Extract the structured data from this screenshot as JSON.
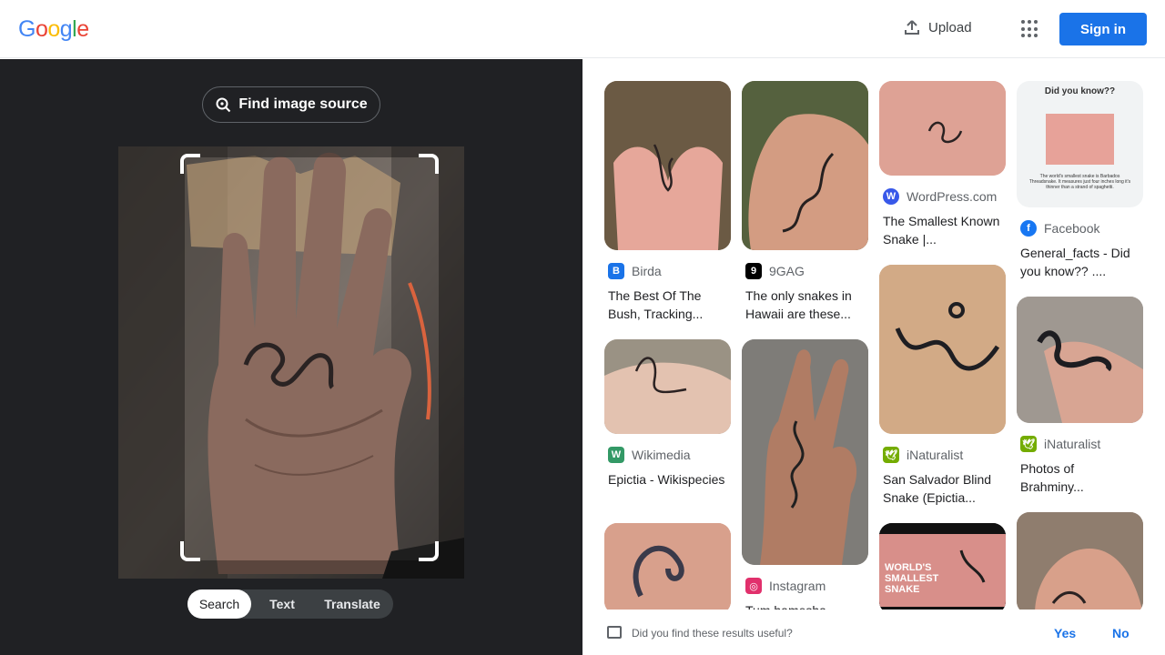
{
  "header": {
    "logo_letters": [
      "G",
      "o",
      "o",
      "g",
      "l",
      "e"
    ],
    "logo_colors": [
      "#4285f4",
      "#ea4335",
      "#fbbc05",
      "#4285f4",
      "#34a853",
      "#ea4335"
    ],
    "upload_label": "Upload",
    "signin_label": "Sign in",
    "accent": "#1a73e8"
  },
  "left": {
    "find_source_label": "Find image source",
    "modes": [
      {
        "label": "Search",
        "active": true
      },
      {
        "label": "Text",
        "active": false
      },
      {
        "label": "Translate",
        "active": false
      }
    ]
  },
  "results": [
    {
      "source": "Birda",
      "icon": "birda-icon",
      "icon_color": "#1a73e8",
      "title": "The Best Of The Bush, Tracking..."
    },
    {
      "source": "9GAG",
      "icon": "9gag-icon",
      "icon_color": "#000000",
      "title": "The only snakes in Hawaii are these..."
    },
    {
      "source": "WordPress.com",
      "icon": "wordpress-icon",
      "icon_color": "#3858e9",
      "title": "The Smallest Known Snake |..."
    },
    {
      "source": "Facebook",
      "icon": "facebook-icon",
      "icon_color": "#1877f2",
      "title": "General_facts - Did you know?? ....",
      "thumb_caption": "Did you know??",
      "thumb_text": "The world's smallest snake is Barbados Threadsnake. It measures just four inches long it's thinner than a strand of spaghetti."
    },
    {
      "source": "Wikimedia",
      "icon": "wikimedia-icon",
      "icon_color": "#339966",
      "title": "Epictia - Wikispecies"
    },
    {
      "source": "Instagram",
      "icon": "instagram-icon",
      "icon_color": "#e1306c",
      "title": "Tum hamesha"
    },
    {
      "source": "iNaturalist",
      "icon": "inaturalist-icon",
      "icon_color": "#74ac00",
      "title": "San Salvador Blind Snake (Epictia..."
    },
    {
      "source": "iNaturalist",
      "icon": "inaturalist-icon",
      "icon_color": "#74ac00",
      "title": "Photos of Brahminy..."
    },
    {
      "source": "",
      "icon": "",
      "icon_color": "",
      "title": "",
      "thumb_text": "WORLD'S SMALLEST SNAKE"
    }
  ],
  "footer": {
    "question": "Did you find these results useful?",
    "yes_label": "Yes",
    "no_label": "No"
  }
}
